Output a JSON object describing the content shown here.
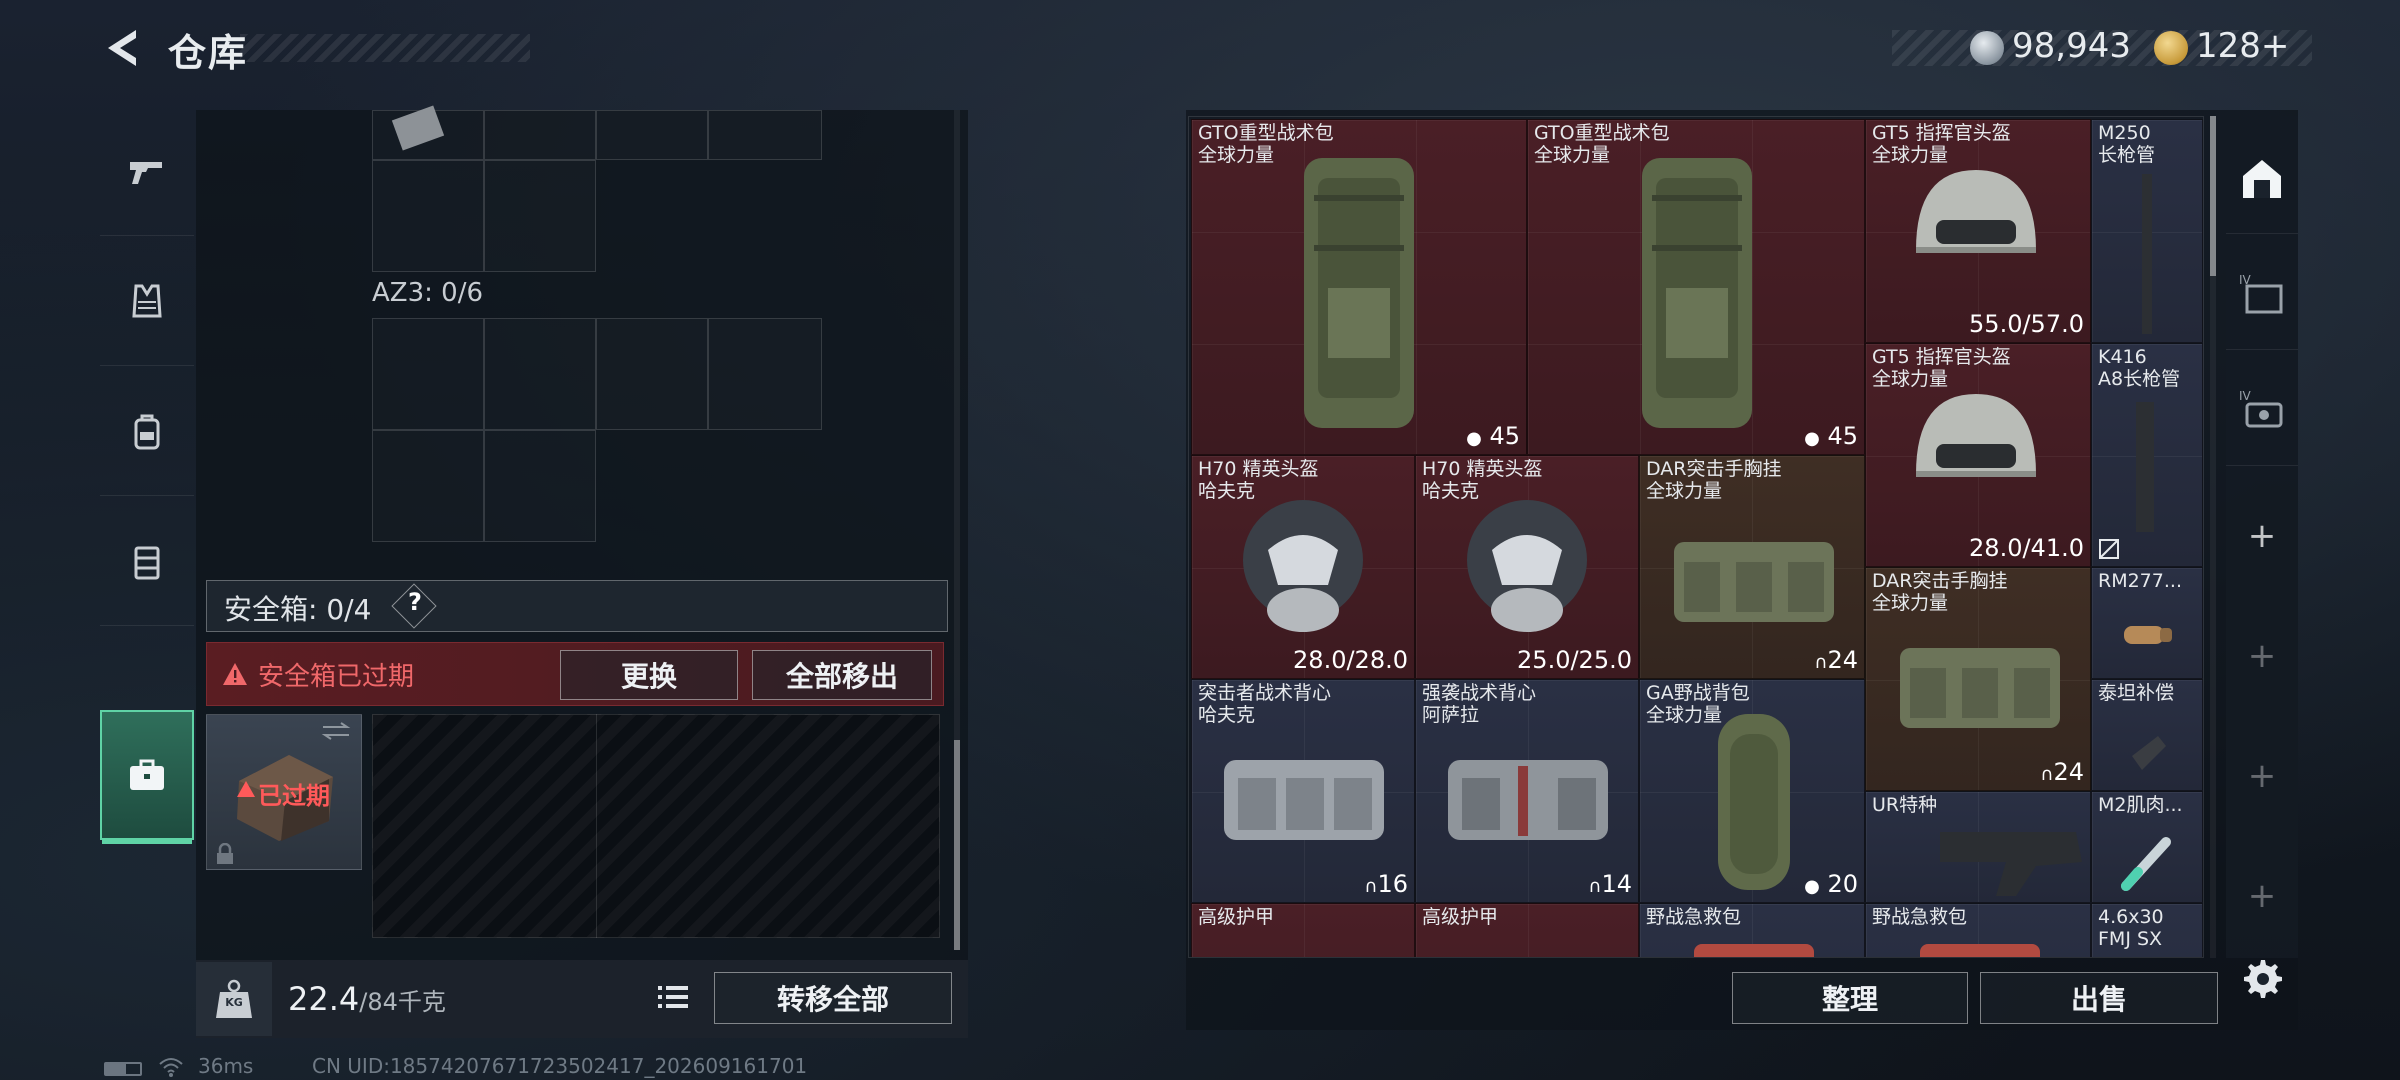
{
  "header": {
    "title": "仓库",
    "currency": [
      {
        "icon": "silver-coin-icon",
        "value": "98,943"
      },
      {
        "icon": "gold-coin-icon",
        "value": "128+"
      }
    ]
  },
  "left_nav": {
    "items": [
      {
        "name": "weapons",
        "icon": "pistol-icon"
      },
      {
        "name": "armor",
        "icon": "vest-icon"
      },
      {
        "name": "backpack",
        "icon": "backpack-icon"
      },
      {
        "name": "chest-rig",
        "icon": "chest-rig-icon"
      },
      {
        "name": "safebox",
        "icon": "briefcase-icon",
        "active": true
      }
    ]
  },
  "loadout": {
    "az3_label": "AZ3: 0/6",
    "safebox_label": "安全箱: 0/4",
    "safebox_help": "?",
    "expired_notice": "安全箱已过期",
    "replace_button": "更换",
    "move_all_button": "全部移出",
    "safebox_expired_tag": "已过期"
  },
  "footer": {
    "weight_current": "22.4",
    "weight_max": "/84千克",
    "kg_label": "KG",
    "transfer_all_button": "转移全部",
    "sort_button": "整理",
    "sell_button": "出售"
  },
  "status": {
    "ping": "36ms",
    "uid": "CN UID:18574207671723502417_202609161701"
  },
  "inventory": [
    {
      "name": "GTO重型战术包",
      "sub": "全球力量",
      "stat": "45",
      "stat_icon": "capacity-icon"
    },
    {
      "name": "GTO重型战术包",
      "sub": "全球力量",
      "stat": "45",
      "stat_icon": "capacity-icon"
    },
    {
      "name": "GT5 指挥官头盔",
      "sub": "全球力量",
      "stat": "55.0/57.0"
    },
    {
      "name": "M250",
      "sub": "长枪管",
      "stat": ""
    },
    {
      "name": "GT5 指挥官头盔",
      "sub": "全球力量",
      "stat": "28.0/41.0"
    },
    {
      "name": "K416",
      "sub": "A8长枪管",
      "stat": ""
    },
    {
      "name": "H70 精英头盔",
      "sub": "哈夫克",
      "stat": "28.0/28.0"
    },
    {
      "name": "H70 精英头盔",
      "sub": "哈夫克",
      "stat": "25.0/25.0"
    },
    {
      "name": "DAR突击手胸挂",
      "sub": "全球力量",
      "stat": "24",
      "stat_icon": "rig-icon"
    },
    {
      "name": "DAR突击手胸挂",
      "sub": "全球力量",
      "stat": "24",
      "stat_icon": "rig-icon"
    },
    {
      "name": "RM277...",
      "sub": "",
      "stat": ""
    },
    {
      "name": "突击者战术背心",
      "sub": "哈夫克",
      "stat": "16",
      "stat_icon": "rig-icon"
    },
    {
      "name": "强袭战术背心",
      "sub": "阿萨拉",
      "stat": "14",
      "stat_icon": "rig-icon"
    },
    {
      "name": "GA野战背包",
      "sub": "全球力量",
      "stat": "20",
      "stat_icon": "capacity-icon"
    },
    {
      "name": "泰坦补偿",
      "sub": "",
      "stat": ""
    },
    {
      "name": "UR特种",
      "sub": "",
      "stat": ""
    },
    {
      "name": "M2肌肉...",
      "sub": "",
      "stat": ""
    },
    {
      "name": "高级护甲",
      "sub": "",
      "stat": ""
    },
    {
      "name": "高级护甲",
      "sub": "",
      "stat": ""
    },
    {
      "name": "野战急救包",
      "sub": "",
      "stat": ""
    },
    {
      "name": "野战急救包",
      "sub": "",
      "stat": ""
    },
    {
      "name": "4.6x30",
      "sub": "FMJ SX",
      "stat": ""
    }
  ],
  "right_tabs": [
    {
      "icon": "stash-icon",
      "active": true
    },
    {
      "icon": "storage-box-iv-icon"
    },
    {
      "icon": "storage-case-iv-icon"
    },
    {
      "icon": "plus-icon",
      "label": "+"
    },
    {
      "icon": "plus-icon",
      "label": "+"
    },
    {
      "icon": "plus-icon",
      "label": "+"
    },
    {
      "icon": "plus-icon",
      "label": "+"
    }
  ],
  "colors": {
    "accent_green": "#5fd3a6",
    "expired_red": "#f0686a",
    "item_red": "#4a1f26",
    "item_blue": "#2a3044",
    "item_brown": "#3f2e24"
  }
}
